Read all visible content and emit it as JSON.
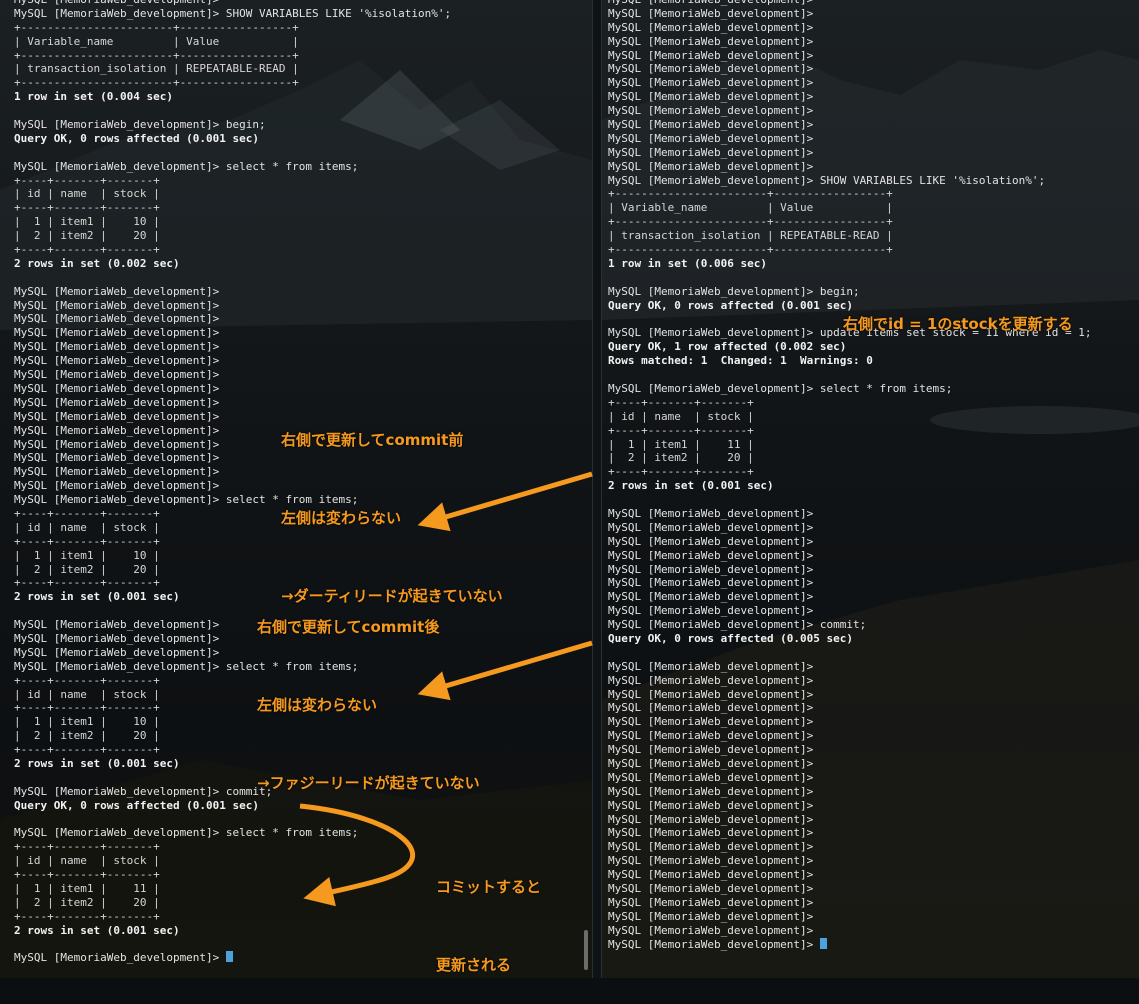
{
  "left_pane": {
    "lines": [
      {
        "t": "MySQL [MemoriaWeb_development]>",
        "s": "n"
      },
      {
        "t": "MySQL [MemoriaWeb_development]> SHOW VARIABLES LIKE '%isolation%';",
        "s": "n"
      },
      {
        "t": "+-----------------------+-----------------+",
        "s": "table"
      },
      {
        "t": "| Variable_name         | Value           |",
        "s": "table"
      },
      {
        "t": "+-----------------------+-----------------+",
        "s": "table"
      },
      {
        "t": "| transaction_isolation | REPEATABLE-READ |",
        "s": "table"
      },
      {
        "t": "+-----------------------+-----------------+",
        "s": "table"
      },
      {
        "t": "1 row in set (0.004 sec)",
        "s": "bold"
      },
      {
        "t": "",
        "s": "n"
      },
      {
        "t": "MySQL [MemoriaWeb_development]> begin;",
        "s": "n"
      },
      {
        "t": "Query OK, 0 rows affected (0.001 sec)",
        "s": "bold"
      },
      {
        "t": "",
        "s": "n"
      },
      {
        "t": "MySQL [MemoriaWeb_development]> select * from items;",
        "s": "n"
      },
      {
        "t": "+----+-------+-------+",
        "s": "table"
      },
      {
        "t": "| id | name  | stock |",
        "s": "table"
      },
      {
        "t": "+----+-------+-------+",
        "s": "table"
      },
      {
        "t": "|  1 | item1 |    10 |",
        "s": "table"
      },
      {
        "t": "|  2 | item2 |    20 |",
        "s": "table"
      },
      {
        "t": "+----+-------+-------+",
        "s": "table"
      },
      {
        "t": "2 rows in set (0.002 sec)",
        "s": "bold"
      },
      {
        "t": "",
        "s": "n"
      },
      {
        "t": "MySQL [MemoriaWeb_development]>",
        "s": "n"
      },
      {
        "t": "MySQL [MemoriaWeb_development]>",
        "s": "n"
      },
      {
        "t": "MySQL [MemoriaWeb_development]>",
        "s": "n"
      },
      {
        "t": "MySQL [MemoriaWeb_development]>",
        "s": "n"
      },
      {
        "t": "MySQL [MemoriaWeb_development]>",
        "s": "n"
      },
      {
        "t": "MySQL [MemoriaWeb_development]>",
        "s": "n"
      },
      {
        "t": "MySQL [MemoriaWeb_development]>",
        "s": "n"
      },
      {
        "t": "MySQL [MemoriaWeb_development]>",
        "s": "n"
      },
      {
        "t": "MySQL [MemoriaWeb_development]>",
        "s": "n"
      },
      {
        "t": "MySQL [MemoriaWeb_development]>",
        "s": "n"
      },
      {
        "t": "MySQL [MemoriaWeb_development]>",
        "s": "n"
      },
      {
        "t": "MySQL [MemoriaWeb_development]>",
        "s": "n"
      },
      {
        "t": "MySQL [MemoriaWeb_development]>",
        "s": "n"
      },
      {
        "t": "MySQL [MemoriaWeb_development]>",
        "s": "n"
      },
      {
        "t": "MySQL [MemoriaWeb_development]>",
        "s": "n"
      },
      {
        "t": "MySQL [MemoriaWeb_development]> select * from items;",
        "s": "n"
      },
      {
        "t": "+----+-------+-------+",
        "s": "table"
      },
      {
        "t": "| id | name  | stock |",
        "s": "table"
      },
      {
        "t": "+----+-------+-------+",
        "s": "table"
      },
      {
        "t": "|  1 | item1 |    10 |",
        "s": "table"
      },
      {
        "t": "|  2 | item2 |    20 |",
        "s": "table"
      },
      {
        "t": "+----+-------+-------+",
        "s": "table"
      },
      {
        "t": "2 rows in set (0.001 sec)",
        "s": "bold"
      },
      {
        "t": "",
        "s": "n"
      },
      {
        "t": "MySQL [MemoriaWeb_development]>",
        "s": "n"
      },
      {
        "t": "MySQL [MemoriaWeb_development]>",
        "s": "n"
      },
      {
        "t": "MySQL [MemoriaWeb_development]>",
        "s": "n"
      },
      {
        "t": "MySQL [MemoriaWeb_development]> select * from items;",
        "s": "n"
      },
      {
        "t": "+----+-------+-------+",
        "s": "table"
      },
      {
        "t": "| id | name  | stock |",
        "s": "table"
      },
      {
        "t": "+----+-------+-------+",
        "s": "table"
      },
      {
        "t": "|  1 | item1 |    10 |",
        "s": "table"
      },
      {
        "t": "|  2 | item2 |    20 |",
        "s": "table"
      },
      {
        "t": "+----+-------+-------+",
        "s": "table"
      },
      {
        "t": "2 rows in set (0.001 sec)",
        "s": "bold"
      },
      {
        "t": "",
        "s": "n"
      },
      {
        "t": "MySQL [MemoriaWeb_development]> commit;",
        "s": "n"
      },
      {
        "t": "Query OK, 0 rows affected (0.001 sec)",
        "s": "bold"
      },
      {
        "t": "",
        "s": "n"
      },
      {
        "t": "MySQL [MemoriaWeb_development]> select * from items;",
        "s": "n"
      },
      {
        "t": "+----+-------+-------+",
        "s": "table"
      },
      {
        "t": "| id | name  | stock |",
        "s": "table"
      },
      {
        "t": "+----+-------+-------+",
        "s": "table"
      },
      {
        "t": "|  1 | item1 |    11 |",
        "s": "table"
      },
      {
        "t": "|  2 | item2 |    20 |",
        "s": "table"
      },
      {
        "t": "+----+-------+-------+",
        "s": "table"
      },
      {
        "t": "2 rows in set (0.001 sec)",
        "s": "bold"
      },
      {
        "t": "",
        "s": "n"
      },
      {
        "t": "MySQL [MemoriaWeb_development]> ",
        "s": "n",
        "cursor": true
      }
    ]
  },
  "right_pane": {
    "lines": [
      {
        "t": "MySQL [MemoriaWeb_development]>",
        "s": "n"
      },
      {
        "t": "MySQL [MemoriaWeb_development]>",
        "s": "n"
      },
      {
        "t": "MySQL [MemoriaWeb_development]>",
        "s": "n"
      },
      {
        "t": "MySQL [MemoriaWeb_development]>",
        "s": "n"
      },
      {
        "t": "MySQL [MemoriaWeb_development]>",
        "s": "n"
      },
      {
        "t": "MySQL [MemoriaWeb_development]>",
        "s": "n"
      },
      {
        "t": "MySQL [MemoriaWeb_development]>",
        "s": "n"
      },
      {
        "t": "MySQL [MemoriaWeb_development]>",
        "s": "n"
      },
      {
        "t": "MySQL [MemoriaWeb_development]>",
        "s": "n"
      },
      {
        "t": "MySQL [MemoriaWeb_development]>",
        "s": "n"
      },
      {
        "t": "MySQL [MemoriaWeb_development]>",
        "s": "n"
      },
      {
        "t": "MySQL [MemoriaWeb_development]>",
        "s": "n"
      },
      {
        "t": "MySQL [MemoriaWeb_development]>",
        "s": "n"
      },
      {
        "t": "MySQL [MemoriaWeb_development]> SHOW VARIABLES LIKE '%isolation%';",
        "s": "n"
      },
      {
        "t": "+-----------------------+-----------------+",
        "s": "table"
      },
      {
        "t": "| Variable_name         | Value           |",
        "s": "table"
      },
      {
        "t": "+-----------------------+-----------------+",
        "s": "table"
      },
      {
        "t": "| transaction_isolation | REPEATABLE-READ |",
        "s": "table"
      },
      {
        "t": "+-----------------------+-----------------+",
        "s": "table"
      },
      {
        "t": "1 row in set (0.006 sec)",
        "s": "bold"
      },
      {
        "t": "",
        "s": "n"
      },
      {
        "t": "MySQL [MemoriaWeb_development]> begin;",
        "s": "n"
      },
      {
        "t": "Query OK, 0 rows affected (0.001 sec)",
        "s": "bold"
      },
      {
        "t": "",
        "s": "n"
      },
      {
        "t": "MySQL [MemoriaWeb_development]> update items set stock = 11 where id = 1;",
        "s": "n"
      },
      {
        "t": "Query OK, 1 row affected (0.002 sec)",
        "s": "bold"
      },
      {
        "t": "Rows matched: 1  Changed: 1  Warnings: 0",
        "s": "bold"
      },
      {
        "t": "",
        "s": "n"
      },
      {
        "t": "MySQL [MemoriaWeb_development]> select * from items;",
        "s": "n"
      },
      {
        "t": "+----+-------+-------+",
        "s": "table"
      },
      {
        "t": "| id | name  | stock |",
        "s": "table"
      },
      {
        "t": "+----+-------+-------+",
        "s": "table"
      },
      {
        "t": "|  1 | item1 |    11 |",
        "s": "table"
      },
      {
        "t": "|  2 | item2 |    20 |",
        "s": "table"
      },
      {
        "t": "+----+-------+-------+",
        "s": "table"
      },
      {
        "t": "2 rows in set (0.001 sec)",
        "s": "bold"
      },
      {
        "t": "",
        "s": "n"
      },
      {
        "t": "MySQL [MemoriaWeb_development]>",
        "s": "n"
      },
      {
        "t": "MySQL [MemoriaWeb_development]>",
        "s": "n"
      },
      {
        "t": "MySQL [MemoriaWeb_development]>",
        "s": "n"
      },
      {
        "t": "MySQL [MemoriaWeb_development]>",
        "s": "n"
      },
      {
        "t": "MySQL [MemoriaWeb_development]>",
        "s": "n"
      },
      {
        "t": "MySQL [MemoriaWeb_development]>",
        "s": "n"
      },
      {
        "t": "MySQL [MemoriaWeb_development]>",
        "s": "n"
      },
      {
        "t": "MySQL [MemoriaWeb_development]>",
        "s": "n"
      },
      {
        "t": "MySQL [MemoriaWeb_development]> commit;",
        "s": "n"
      },
      {
        "t": "Query OK, 0 rows affected (0.005 sec)",
        "s": "bold"
      },
      {
        "t": "",
        "s": "n"
      },
      {
        "t": "MySQL [MemoriaWeb_development]>",
        "s": "n"
      },
      {
        "t": "MySQL [MemoriaWeb_development]>",
        "s": "n"
      },
      {
        "t": "MySQL [MemoriaWeb_development]>",
        "s": "n"
      },
      {
        "t": "MySQL [MemoriaWeb_development]>",
        "s": "n"
      },
      {
        "t": "MySQL [MemoriaWeb_development]>",
        "s": "n"
      },
      {
        "t": "MySQL [MemoriaWeb_development]>",
        "s": "n"
      },
      {
        "t": "MySQL [MemoriaWeb_development]>",
        "s": "n"
      },
      {
        "t": "MySQL [MemoriaWeb_development]>",
        "s": "n"
      },
      {
        "t": "MySQL [MemoriaWeb_development]>",
        "s": "n"
      },
      {
        "t": "MySQL [MemoriaWeb_development]>",
        "s": "n"
      },
      {
        "t": "MySQL [MemoriaWeb_development]>",
        "s": "n"
      },
      {
        "t": "MySQL [MemoriaWeb_development]>",
        "s": "n"
      },
      {
        "t": "MySQL [MemoriaWeb_development]>",
        "s": "n"
      },
      {
        "t": "MySQL [MemoriaWeb_development]>",
        "s": "n"
      },
      {
        "t": "MySQL [MemoriaWeb_development]>",
        "s": "n"
      },
      {
        "t": "MySQL [MemoriaWeb_development]>",
        "s": "n"
      },
      {
        "t": "MySQL [MemoriaWeb_development]>",
        "s": "n"
      },
      {
        "t": "MySQL [MemoriaWeb_development]>",
        "s": "n"
      },
      {
        "t": "MySQL [MemoriaWeb_development]>",
        "s": "n"
      },
      {
        "t": "MySQL [MemoriaWeb_development]>",
        "s": "n"
      },
      {
        "t": "MySQL [MemoriaWeb_development]> ",
        "s": "n",
        "cursor": true
      }
    ]
  },
  "annotations": {
    "right_update": "右側でid = 1のstockを更新する",
    "before_commit": [
      "右側で更新してcommit前",
      "左側は変わらない",
      "→ダーティリードが起きていない"
    ],
    "after_commit": [
      "右側で更新してcommit後",
      "左側は変わらない",
      "→ファジーリードが起きていない"
    ],
    "on_commit": [
      "コミットすると",
      "更新される"
    ]
  },
  "colors": {
    "annotation": "#f5991f",
    "cursor": "#4aa3df",
    "text": "#e3e3e3"
  }
}
